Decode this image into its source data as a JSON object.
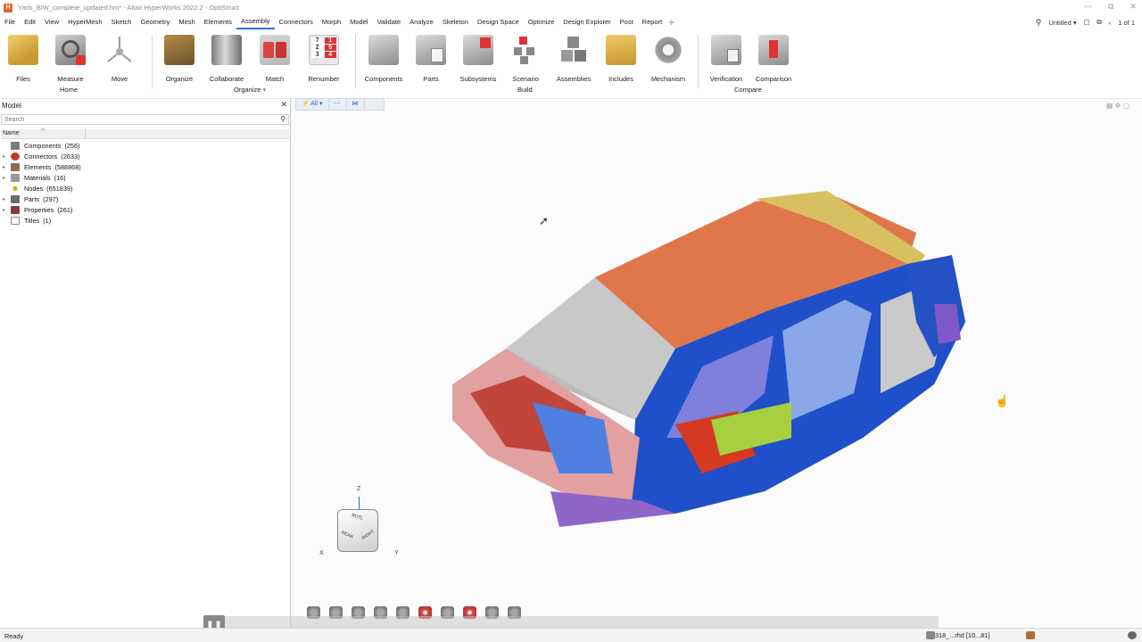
{
  "window": {
    "title": "Yaris_BIW_complete_updated.hm* - Altair HyperWorks 2022.2 - OptiStruct",
    "app_icon_letter": "H",
    "controls": [
      "—",
      "⧉",
      "✕"
    ]
  },
  "menubar": {
    "items": [
      "File",
      "Edit",
      "View",
      "HyperMesh",
      "Sketch",
      "Geometry",
      "Mesh",
      "Elements",
      "Assembly",
      "Connectors",
      "Morph",
      "Model",
      "Validate",
      "Analyze",
      "Skeleton",
      "Design Space",
      "Optimize",
      "Design Explorer",
      "Post",
      "Report"
    ],
    "active": "Assembly",
    "session": "Untitled",
    "page_counter": "1 of 1"
  },
  "ribbon": {
    "tools": [
      {
        "id": "files",
        "label": "Files"
      },
      {
        "id": "measure",
        "label": "Measure"
      },
      {
        "id": "move",
        "label": "Move"
      },
      {
        "id": "organize",
        "label": "Organize"
      },
      {
        "id": "collaborate",
        "label": "Collaborate"
      },
      {
        "id": "match",
        "label": "Match"
      },
      {
        "id": "renumber",
        "label": "Renumber"
      },
      {
        "id": "components",
        "label": "Components"
      },
      {
        "id": "parts",
        "label": "Parts"
      },
      {
        "id": "subsystems",
        "label": "Subsystems"
      },
      {
        "id": "scenario",
        "label": "Scenario"
      },
      {
        "id": "assemblies",
        "label": "Assemblies"
      },
      {
        "id": "includes",
        "label": "Includes"
      },
      {
        "id": "mechanism",
        "label": "Mechanism"
      },
      {
        "id": "verification",
        "label": "Verification"
      },
      {
        "id": "comparison",
        "label": "Comparison"
      }
    ],
    "groups": {
      "home": "Home",
      "organize": "Organize",
      "build": "Build",
      "compare": "Compare"
    },
    "renumber_digits": [
      "7",
      "1",
      "2",
      "5",
      "3",
      "4"
    ]
  },
  "model_browser": {
    "title": "Model",
    "search_placeholder": "Search",
    "column_name": "Name",
    "items": [
      {
        "label": "Components",
        "count": "(256)",
        "color": "#7c7c7c",
        "expandable": false
      },
      {
        "label": "Connectors",
        "count": "(2633)",
        "color": "#c0392b",
        "expandable": true
      },
      {
        "label": "Elements",
        "count": "(588868)",
        "color": "#8a6e4b",
        "expandable": true
      },
      {
        "label": "Materials",
        "count": "(16)",
        "color": "#9a9a9a",
        "expandable": true
      },
      {
        "label": "Nodes",
        "count": "(651839)",
        "color": "#c9b400",
        "expandable": false
      },
      {
        "label": "Parts",
        "count": "(297)",
        "color": "#6d6d6d",
        "expandable": true
      },
      {
        "label": "Properties",
        "count": "(261)",
        "color": "#8b3a3a",
        "expandable": true
      },
      {
        "label": "Titles",
        "count": "(1)",
        "color": "#8a8a8a",
        "expandable": false
      }
    ]
  },
  "viewport": {
    "filter_label": "All",
    "axes": {
      "z": "Z",
      "x": "X",
      "y": "Y"
    },
    "view_cube": {
      "top": "BOTL",
      "left": "REAR",
      "right": "RIGHT"
    }
  },
  "status": {
    "ready": "Ready",
    "file_info": "318_...rhd [10...81]"
  },
  "colors": {
    "accent": "#2b76c9",
    "body_blue": "#1f4fc9",
    "roof_orange": "#e0774a"
  }
}
